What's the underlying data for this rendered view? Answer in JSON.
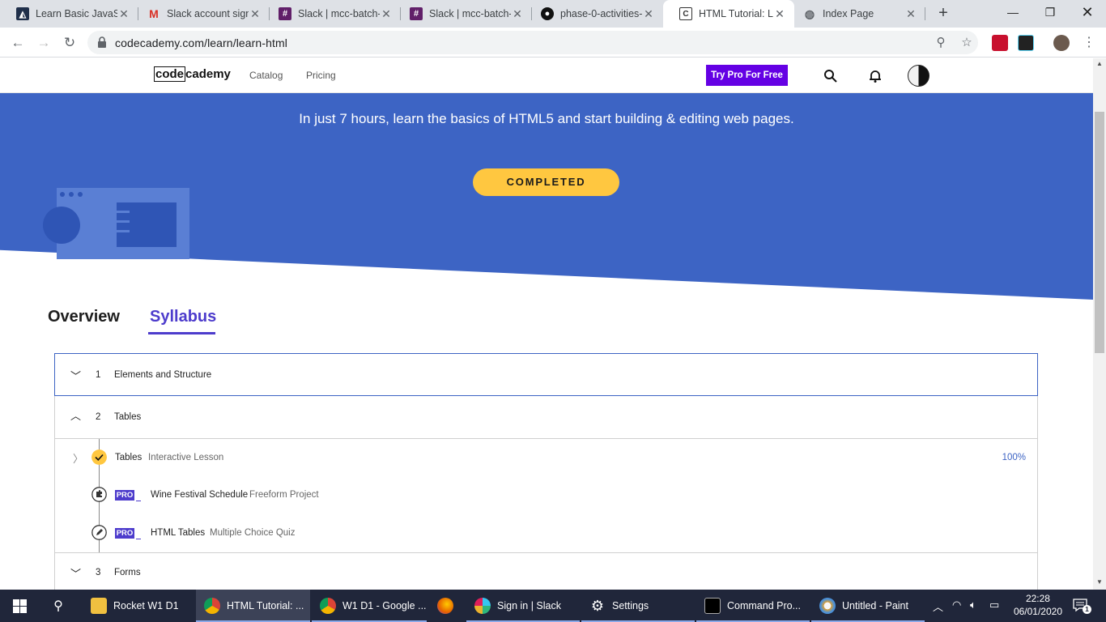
{
  "browser": {
    "tabs": [
      {
        "title": "Learn Basic JavaSc",
        "icon": "codecademy-icon"
      },
      {
        "title": "Slack account sign",
        "icon": "gmail-icon"
      },
      {
        "title": "Slack | mcc-batch-",
        "icon": "slack-icon"
      },
      {
        "title": "Slack | mcc-batch-",
        "icon": "slack-icon"
      },
      {
        "title": "phase-0-activities-",
        "icon": "github-icon"
      },
      {
        "title": "HTML Tutorial: Lea",
        "icon": "codecademy-icon"
      },
      {
        "title": "Index Page",
        "icon": "globe-icon"
      }
    ],
    "url": "codecademy.com/learn/learn-html"
  },
  "site": {
    "logo_box": "code",
    "logo_rest": "cademy",
    "nav": [
      "Catalog",
      "Pricing"
    ],
    "pro_button": "Try Pro For Free"
  },
  "hero": {
    "text": "In just 7 hours, learn the basics of HTML5 and start building & editing web pages.",
    "status_button": "COMPLETED"
  },
  "page_tabs": {
    "overview": "Overview",
    "syllabus": "Syllabus"
  },
  "syllabus": {
    "modules": [
      {
        "num": "1",
        "title": "Elements and Structure"
      },
      {
        "num": "2",
        "title": "Tables"
      },
      {
        "num": "3",
        "title": "Forms"
      }
    ],
    "lessons": [
      {
        "title": "Tables",
        "type": "Interactive Lesson",
        "progress": "100%"
      },
      {
        "badge": "PRO",
        "title": "Wine Festival Schedule",
        "type": "Freeform Project"
      },
      {
        "badge": "PRO",
        "title": "HTML Tables",
        "type": "Multiple Choice Quiz"
      }
    ]
  },
  "taskbar": {
    "items": [
      "Rocket W1 D1",
      "HTML Tutorial: ...",
      "W1 D1 - Google ...",
      "Sign in | Slack",
      "Settings",
      "Command Pro...",
      "Untitled - Paint"
    ],
    "time": "22:28",
    "date": "06/01/2020",
    "notifications": "1"
  },
  "colors": {
    "hero_blue": "#3d64c4",
    "pro_purple": "#6400e4",
    "accent_purple": "#4d3ccc",
    "completed_yellow": "#ffc740"
  }
}
